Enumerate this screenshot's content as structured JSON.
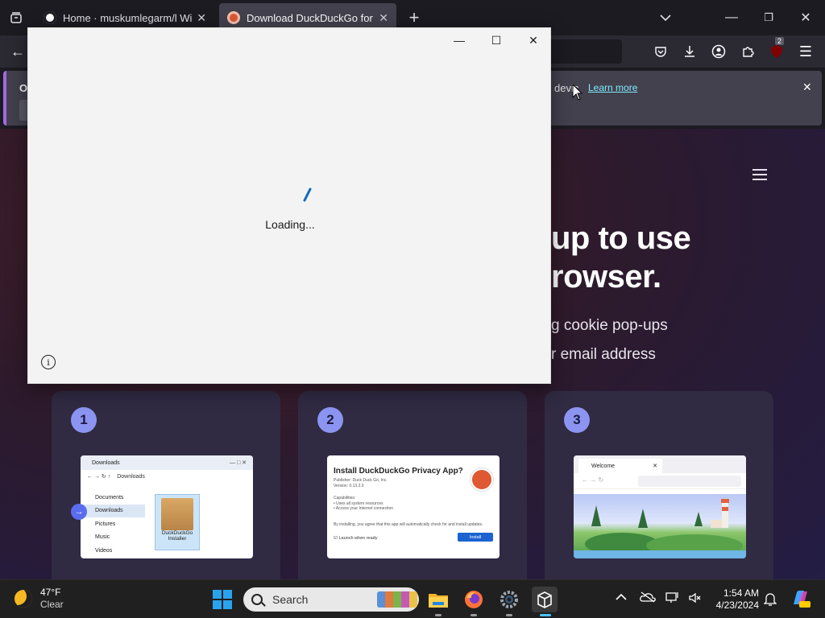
{
  "browser": {
    "tabs": [
      {
        "title": "Home · muskumlegarm/l Wiki",
        "active": false
      },
      {
        "title": "Download DuckDuckGo for Wi",
        "active": true
      }
    ],
    "extension_badge": "2",
    "notification": {
      "lead_text": "Op",
      "device_text": "devic",
      "link": "Learn more"
    }
  },
  "page": {
    "headline_line1": "up to use",
    "headline_line2": "rowser.",
    "sub_line1": "g cookie pop-ups",
    "sub_line2": "r email address",
    "steps": [
      {
        "number": "1",
        "explorer": {
          "tab": "Downloads",
          "path": "Downloads",
          "sidebar": [
            "Documents",
            "Downloads",
            "Pictures",
            "Music",
            "Videos"
          ],
          "file": "DuckDuckGo Installer"
        }
      },
      {
        "number": "2",
        "dialog": {
          "title": "Install DuckDuckGo Privacy App?",
          "publisher": "Publisher: Duck Duck Go, Inc.",
          "version": "Version: 0.13.2.0",
          "capabilities": "Capabilities:",
          "cap1": "• Uses all system resources",
          "cap2": "• Access your Internet connection",
          "note": "By installing, you agree that this app will automatically check for and install updates.",
          "launch": "Launch when ready",
          "install": "Install"
        }
      },
      {
        "number": "3",
        "browser_tab": "Welcome"
      }
    ]
  },
  "popup": {
    "loading_text": "Loading...",
    "info_glyph": "i"
  },
  "taskbar": {
    "weather_temp": "47°F",
    "weather_cond": "Clear",
    "search_placeholder": "Search",
    "time": "1:54 AM",
    "date": "4/23/2024"
  },
  "colors": {
    "accent": "#8c94f1",
    "popup_bg": "#f3f3f3",
    "taskbar": "#202020",
    "spinner": "#0f6cbd"
  }
}
